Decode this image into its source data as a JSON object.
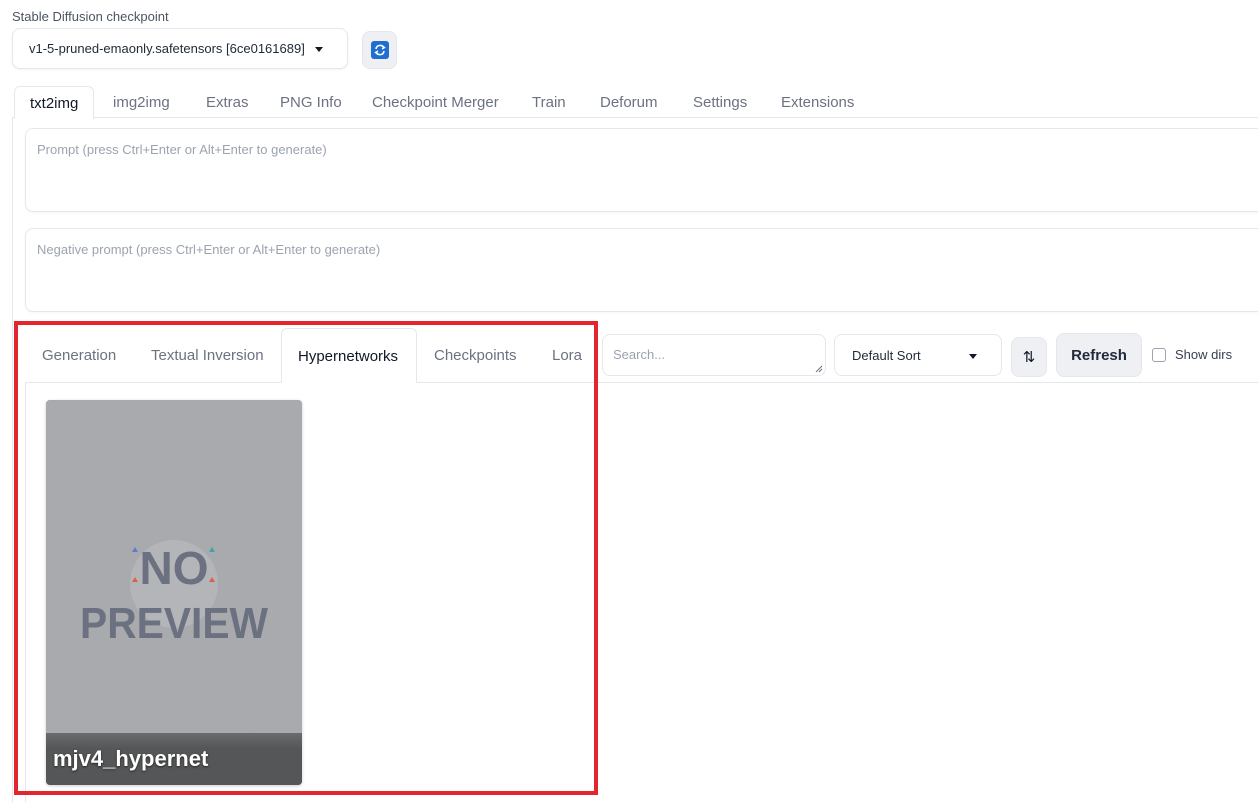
{
  "checkpoint": {
    "label": "Stable Diffusion checkpoint",
    "value": "v1-5-pruned-emaonly.safetensors [6ce0161689]",
    "refresh_icon": "refresh-icon"
  },
  "main_tabs": [
    {
      "label": "txt2img",
      "active": true
    },
    {
      "label": "img2img"
    },
    {
      "label": "Extras"
    },
    {
      "label": "PNG Info"
    },
    {
      "label": "Checkpoint Merger"
    },
    {
      "label": "Train"
    },
    {
      "label": "Deforum"
    },
    {
      "label": "Settings"
    },
    {
      "label": "Extensions"
    }
  ],
  "prompt": {
    "placeholder": "Prompt (press Ctrl+Enter or Alt+Enter to generate)",
    "value": ""
  },
  "negative_prompt": {
    "placeholder": "Negative prompt (press Ctrl+Enter or Alt+Enter to generate)",
    "value": ""
  },
  "extra_networks": {
    "tabs": [
      {
        "label": "Generation"
      },
      {
        "label": "Textual Inversion"
      },
      {
        "label": "Hypernetworks",
        "active": true
      },
      {
        "label": "Checkpoints"
      },
      {
        "label": "Lora"
      }
    ],
    "search": {
      "placeholder": "Search...",
      "value": ""
    },
    "sort": {
      "value": "Default Sort"
    },
    "sort_direction_label": "⇅",
    "refresh_label": "Refresh",
    "show_dirs": {
      "label": "Show dirs",
      "checked": false
    },
    "cards": [
      {
        "name": "mjv4_hypernet",
        "preview_text_line1": "NO",
        "preview_text_line2": "PREVIEW"
      }
    ]
  },
  "colors": {
    "highlight": "#e3262e",
    "card_bg": "#a8aaad",
    "refresh_icon": "#1e6fd0"
  }
}
